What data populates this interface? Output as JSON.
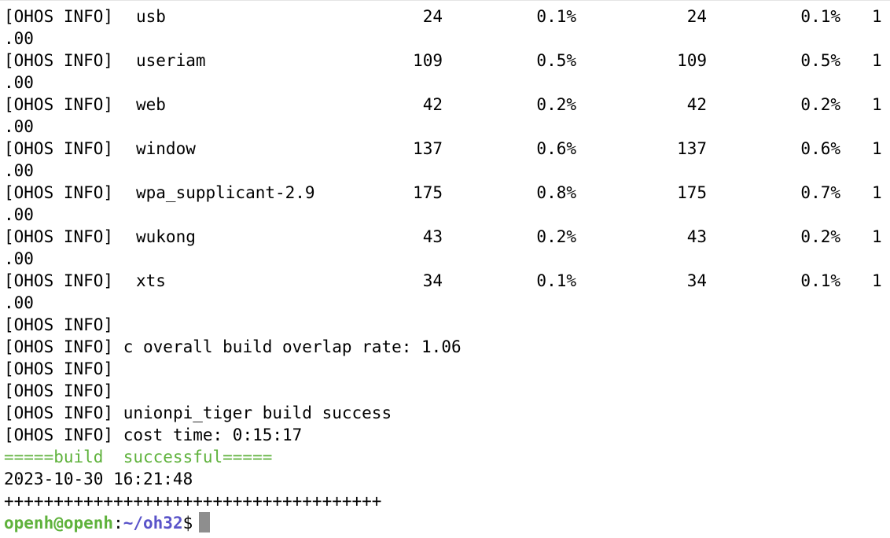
{
  "rows": [
    {
      "prefix": "[OHOS INFO]",
      "name": "usb",
      "v1": "24",
      "p1": "0.1%",
      "v2": "24",
      "p2": "0.1%",
      "r": "1",
      "wrap": ".00"
    },
    {
      "prefix": "[OHOS INFO]",
      "name": "useriam",
      "v1": "109",
      "p1": "0.5%",
      "v2": "109",
      "p2": "0.5%",
      "r": "1",
      "wrap": ".00"
    },
    {
      "prefix": "[OHOS INFO]",
      "name": "web",
      "v1": "42",
      "p1": "0.2%",
      "v2": "42",
      "p2": "0.2%",
      "r": "1",
      "wrap": ".00"
    },
    {
      "prefix": "[OHOS INFO]",
      "name": "window",
      "v1": "137",
      "p1": "0.6%",
      "v2": "137",
      "p2": "0.6%",
      "r": "1",
      "wrap": ".00"
    },
    {
      "prefix": "[OHOS INFO]",
      "name": "wpa_supplicant-2.9",
      "v1": "175",
      "p1": "0.8%",
      "v2": "175",
      "p2": "0.7%",
      "r": "1",
      "wrap": ".00"
    },
    {
      "prefix": "[OHOS INFO]",
      "name": "wukong",
      "v1": "43",
      "p1": "0.2%",
      "v2": "43",
      "p2": "0.2%",
      "r": "1",
      "wrap": ".00"
    },
    {
      "prefix": "[OHOS INFO]",
      "name": "xts",
      "v1": "34",
      "p1": "0.1%",
      "v2": "34",
      "p2": "0.1%",
      "r": "1",
      "wrap": ".00"
    }
  ],
  "log": {
    "prefix": "[OHOS INFO]",
    "overlap": "c overall build overlap rate: 1.06",
    "success": "unionpi_tiger build success",
    "cost": "cost time: 0:15:17"
  },
  "banner": "=====build  successful=====",
  "timestamp": "2023-10-30 16:21:48",
  "separator": "++++++++++++++++++++++++++++++++++++++",
  "prompt": {
    "user": "openh@openh",
    "colon": ":",
    "path": "~/oh32",
    "symbol": "$"
  },
  "colors": {
    "success_green": "#5fb23c",
    "path_purple": "#5a54c9",
    "cursor_gray": "#8e8e8e"
  }
}
